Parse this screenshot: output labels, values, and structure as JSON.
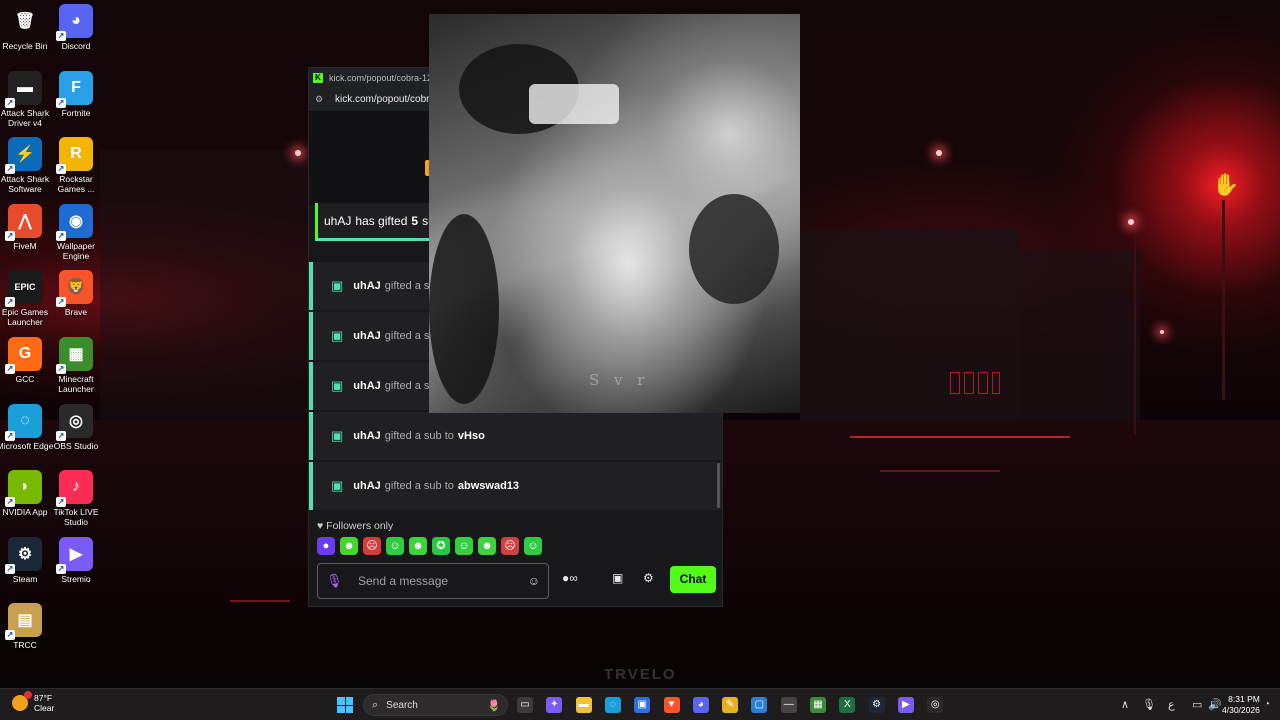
{
  "desktop": {
    "icons": [
      {
        "label": "Recycle Bin",
        "icon": "recycle-bin-icon",
        "glyph": "🗑",
        "bg": "transparent",
        "shortcut": false
      },
      {
        "label": "Discord",
        "icon": "discord-icon",
        "glyph": "◕",
        "bg": "#5865f2",
        "shortcut": true
      },
      {
        "label": "Attack Shark Driver v4",
        "icon": "attack-shark-driver-icon",
        "glyph": "▬",
        "bg": "#222",
        "shortcut": true
      },
      {
        "label": "Fortnite",
        "icon": "fortnite-icon",
        "glyph": "F",
        "bg": "#2aa0e8",
        "shortcut": true
      },
      {
        "label": "Attack Shark Software",
        "icon": "attack-shark-software-icon",
        "glyph": "⚡",
        "bg": "#0d6ab8",
        "shortcut": true
      },
      {
        "label": "Rockstar Games ...",
        "icon": "rockstar-icon",
        "glyph": "R",
        "bg": "#f5b400",
        "shortcut": true
      },
      {
        "label": "FiveM",
        "icon": "fivem-icon",
        "glyph": "⋀",
        "bg": "#e84a2c",
        "shortcut": true
      },
      {
        "label": "Wallpaper Engine",
        "icon": "wallpaper-engine-icon",
        "glyph": "◉",
        "bg": "#1f6bd1",
        "shortcut": true
      },
      {
        "label": "Epic Games Launcher",
        "icon": "epic-games-icon",
        "glyph": "EPIC",
        "bg": "#1a1a1a",
        "shortcut": true
      },
      {
        "label": "Brave",
        "icon": "brave-icon",
        "glyph": "🦁",
        "bg": "#fb542b",
        "shortcut": true
      },
      {
        "label": "GCC",
        "icon": "gcc-icon",
        "glyph": "G",
        "bg": "#ff6a14",
        "shortcut": true
      },
      {
        "label": "Minecraft Launcher",
        "icon": "minecraft-icon",
        "glyph": "▦",
        "bg": "#3c8c2c",
        "shortcut": true
      },
      {
        "label": "Microsoft Edge",
        "icon": "edge-icon",
        "glyph": "◌",
        "bg": "#1a9fd8",
        "shortcut": true
      },
      {
        "label": "OBS Studio",
        "icon": "obs-icon",
        "glyph": "◎",
        "bg": "#2a2a2a",
        "shortcut": true
      },
      {
        "label": "NVIDIA App",
        "icon": "nvidia-icon",
        "glyph": "◗",
        "bg": "#76b900",
        "shortcut": true
      },
      {
        "label": "TikTok LIVE Studio",
        "icon": "tiktok-live-icon",
        "glyph": "♪",
        "bg": "#fe2c55",
        "shortcut": true
      },
      {
        "label": "Steam",
        "icon": "steam-icon",
        "glyph": "⚙",
        "bg": "#1b2838",
        "shortcut": true
      },
      {
        "label": "Stremio",
        "icon": "stremio-icon",
        "glyph": "▶",
        "bg": "#7b5bf5",
        "shortcut": true
      },
      {
        "label": "TRCC",
        "icon": "trcc-icon",
        "glyph": "▤",
        "bg": "#c8a050",
        "shortcut": true
      }
    ]
  },
  "kick": {
    "tab_title": "kick.com/popout/cobra-12/cl",
    "url": "kick.com/popout/cobra",
    "gift_banner": {
      "user": "uhAJ",
      "text": "has gifted",
      "count": "5",
      "rest": "su"
    },
    "messages": [
      {
        "user": "uhAJ",
        "verb": "gifted a su",
        "target": ""
      },
      {
        "user": "uhAJ",
        "verb": "gifted a su",
        "target": ""
      },
      {
        "user": "uhAJ",
        "verb": "gifted a su",
        "target": ""
      },
      {
        "user": "uhAJ",
        "verb": "gifted a sub to",
        "target": "vHso"
      },
      {
        "user": "uhAJ",
        "verb": "gifted a sub to",
        "target": "abwswad13"
      }
    ],
    "followers_only": "Followers only",
    "emotes": [
      {
        "icon": "purple-emote-icon",
        "glyph": "●",
        "bg": "#6a3cf0"
      },
      {
        "icon": "green-emote-icon",
        "glyph": "☻",
        "bg": "#44d62c"
      },
      {
        "icon": "red-emote-icon",
        "glyph": "☹",
        "bg": "#d83a3a"
      },
      {
        "icon": "ghost-emote-icon",
        "glyph": "☺",
        "bg": "#2ecc40"
      },
      {
        "icon": "frog-emote-icon",
        "glyph": "☻",
        "bg": "#3bd43b"
      },
      {
        "icon": "dizzy-emote-icon",
        "glyph": "✪",
        "bg": "#27c93f"
      },
      {
        "icon": "blob-emote-icon",
        "glyph": "☺",
        "bg": "#30d040"
      },
      {
        "icon": "smile-emote-icon",
        "glyph": "☻",
        "bg": "#40d040"
      },
      {
        "icon": "angry-emote-icon",
        "glyph": "☹",
        "bg": "#d04040"
      },
      {
        "icon": "sweat-emote-icon",
        "glyph": "☺",
        "bg": "#2ecc40"
      }
    ],
    "input_placeholder": "Send a message",
    "chat_button": "Chat",
    "accent": "#53fc18",
    "gift_accent": "#53e0b0"
  },
  "video": {
    "watermark_text": "S v r"
  },
  "wallpaper": {
    "watermark": "TRVELO"
  },
  "taskbar": {
    "weather_temp": "87°F",
    "weather_cond": "Clear",
    "search_label": "Search",
    "apps": [
      {
        "icon": "task-view-icon",
        "glyph": "▭",
        "bg": "#3a3a3a"
      },
      {
        "icon": "copilot-icon",
        "glyph": "✦",
        "bg": "#7a5cf0"
      },
      {
        "icon": "file-explorer-icon",
        "glyph": "▬",
        "bg": "#f2c230"
      },
      {
        "icon": "edge-taskbar-icon",
        "glyph": "◌",
        "bg": "#1a9fd8"
      },
      {
        "icon": "store-icon",
        "glyph": "▣",
        "bg": "#2d6fe0"
      },
      {
        "icon": "brave-taskbar-icon",
        "glyph": "▼",
        "bg": "#fb542b"
      },
      {
        "icon": "discord-taskbar-icon",
        "glyph": "◕",
        "bg": "#5865f2"
      },
      {
        "icon": "pen-app-icon",
        "glyph": "✎",
        "bg": "#e8b020"
      },
      {
        "icon": "window-app-icon",
        "glyph": "▢",
        "bg": "#2a7fd4"
      },
      {
        "icon": "minus-app-icon",
        "glyph": "—",
        "bg": "#444"
      },
      {
        "icon": "grid-app-icon",
        "glyph": "▦",
        "bg": "#3a8a3a"
      },
      {
        "icon": "excel-icon",
        "glyph": "X",
        "bg": "#1d6f42"
      },
      {
        "icon": "steam-taskbar-icon",
        "glyph": "⚙",
        "bg": "#1b2838"
      },
      {
        "icon": "stremio-taskbar-icon",
        "glyph": "▶",
        "bg": "#7b5bf5"
      },
      {
        "icon": "obs-taskbar-icon",
        "glyph": "◎",
        "bg": "#2a2a2a"
      }
    ],
    "clock_time": "8:31 PM",
    "clock_date": "4/30/2026"
  }
}
